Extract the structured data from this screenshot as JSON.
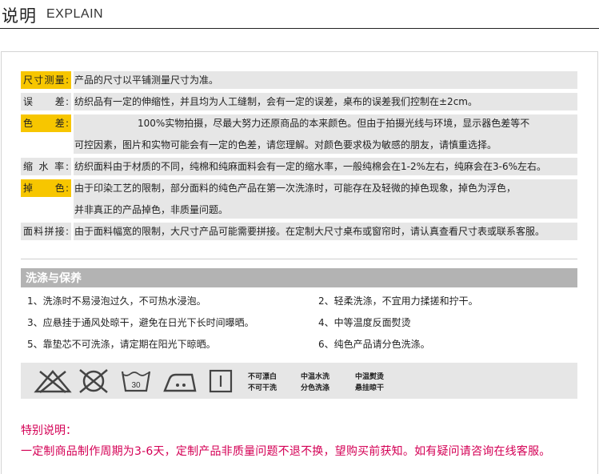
{
  "header": {
    "title_zh": "说明",
    "title_en": "EXPLAIN"
  },
  "explain_rows": [
    {
      "label": "尺寸测量:",
      "lines": [
        "产品的尺寸以平铺测量尺寸为准。"
      ]
    },
    {
      "label": "误　　差:",
      "lines": [
        "纺织品有一定的伸缩性，并且均为人工缝制，会有一定的误差，桌布的误差我们控制在±2cm。"
      ]
    },
    {
      "label": "色　　差:",
      "lines": [
        "100%实物拍摄，尽最大努力还原商品的本来颜色。但由于拍摄光线与环境，显示器色差等不",
        "可控因素，图片和实物可能会有一定的色差，请您理解。对颜色要求极为敏感的朋友，请慎重选择。"
      ]
    },
    {
      "label": "缩 水 率:",
      "lines": [
        "纺织面料由于材质的不同，纯棉和纯麻面料会有一定的缩水率，一般纯棉会在1-2%左右，纯麻会在3-6%左右。"
      ]
    },
    {
      "label": "掉　　色:",
      "lines": [
        "由于印染工艺的限制，部分面料的纯色产品在第一次洗涤时，可能存在及轻微的掉色现象，掉色为浮色，",
        "并非真正的产品掉色，非质量问题。"
      ]
    },
    {
      "label": "面料拼接:",
      "lines": [
        "由于面料幅宽的限制，大尺寸产品可能需要拼接。在定制大尺寸桌布或窗帘时，请认真查看尺寸表或联系客服。"
      ]
    }
  ],
  "care": {
    "title": "洗涤与保养",
    "items": [
      "1、洗涤时不易浸泡过久，不可热水浸泡。",
      "2、轻柔洗涤，不宜用力揉搓和拧干。",
      "3、应悬挂于通风处晾干，避免在日光下长时间曝晒。",
      "4、中等温度反面熨烫",
      "5、靠垫芯不可洗涤，请定期在阳光下晾晒。",
      "6、纯色产品请分色洗涤。"
    ],
    "icons": [
      "no-bleach-icon",
      "no-tumble-dry-icon",
      "wash-30-icon",
      "iron-medium-icon",
      "hang-dry-icon"
    ],
    "wash_temp": "30",
    "symbol_texts": [
      "不可漂白",
      "不可干洗",
      "中温水洗",
      "分色洗涤",
      "中温熨烫",
      "悬挂晾干"
    ]
  },
  "note": {
    "title": "特别说明：",
    "text": "一定制商品制作周期为3-6天，定制产品非质量问题不退不换，望购买前获知。如有疑问请咨询在线客服。"
  },
  "colors": {
    "label_highlight": "#f7c600",
    "row_bg": "#e6e6e6",
    "care_bar": "#b3b3b3",
    "note_text": "#d40055"
  }
}
